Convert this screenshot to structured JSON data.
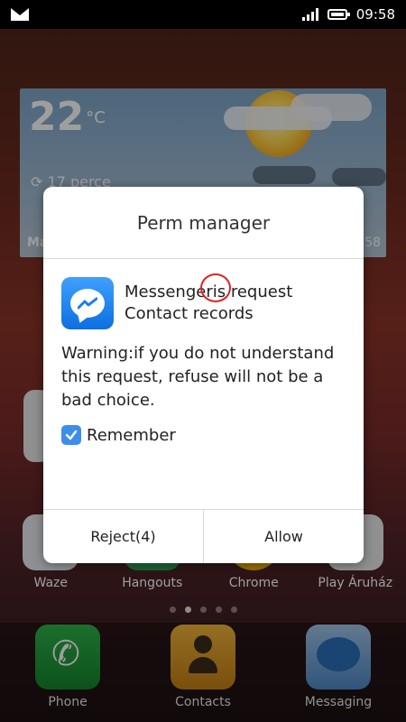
{
  "status_bar": {
    "time": "09:58"
  },
  "weather": {
    "temperature": "22",
    "unit": "°C",
    "refresh_text": "17 perce",
    "bottom_left": "Ma",
    "bottom_right": "58"
  },
  "home": {
    "apps": [
      "Waze",
      "Hangouts",
      "Chrome",
      "Play Áruház"
    ],
    "page_dots": 5,
    "active_dot": 1,
    "dock": [
      "Phone",
      "Contacts",
      "Messaging"
    ]
  },
  "dialog": {
    "title": "Perm manager",
    "request_line1": "Messengeris request",
    "request_line2": "Contact records",
    "warning": "Warning:if you do not understand this request, refuse will not be a bad choice.",
    "remember_label": "Remember",
    "remember_checked": true,
    "reject_label": "Reject(4)",
    "allow_label": "Allow"
  }
}
